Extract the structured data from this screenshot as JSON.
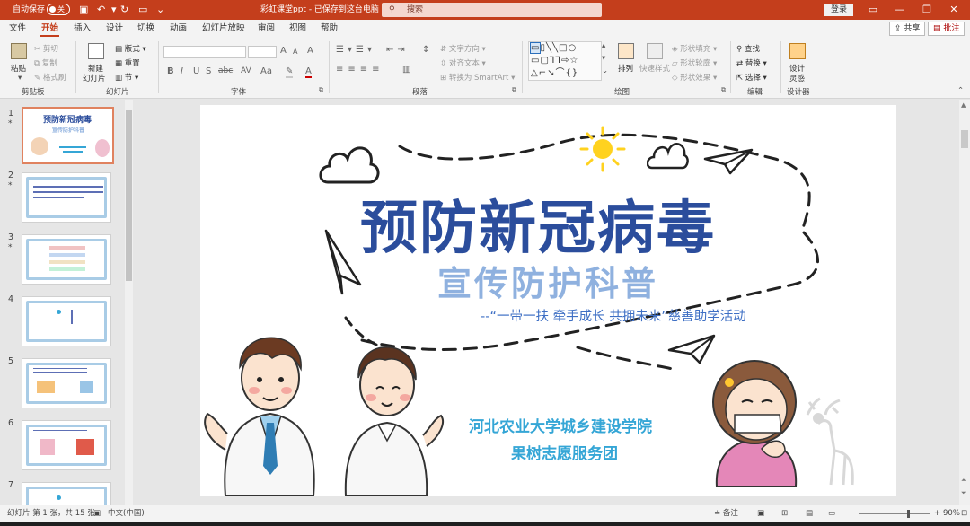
{
  "titlebar": {
    "autosave_label": "自动保存",
    "autosave_state": "关",
    "doc_title": "彩虹课堂ppt - 已保存到这台电脑",
    "search_placeholder": "搜索",
    "login_label": "登录"
  },
  "tabs": [
    "文件",
    "开始",
    "插入",
    "设计",
    "切换",
    "动画",
    "幻灯片放映",
    "审阅",
    "视图",
    "帮助"
  ],
  "active_tab": "开始",
  "share_label": "共享",
  "comment_label": "批注",
  "ribbon": {
    "clipboard": {
      "paste": "粘贴",
      "cut": "剪切",
      "copy": "复制",
      "format_painter": "格式刷",
      "label": "剪贴板"
    },
    "slides": {
      "new_slide_line1": "新建",
      "new_slide_line2": "幻灯片",
      "layout": "版式",
      "reset": "重置",
      "section": "节",
      "label": "幻灯片"
    },
    "font": {
      "label": "字体",
      "bold": "B",
      "italic": "I",
      "underline": "U",
      "strike": "S",
      "shadow": "abc",
      "spacing": "AV",
      "case": "Aa",
      "grow": "A",
      "shrink": "A",
      "clear": "A",
      "color": "A"
    },
    "paragraph": {
      "text_direction": "文字方向",
      "align_text": "对齐文本",
      "smartart": "转换为 SmartArt",
      "label": "段落"
    },
    "drawing": {
      "arrange": "排列",
      "quick_styles": "快速样式",
      "shape_fill": "形状填充",
      "shape_outline": "形状轮廓",
      "shape_effects": "形状效果",
      "label": "绘图"
    },
    "editing": {
      "find": "查找",
      "replace": "替换",
      "select": "选择",
      "label": "编辑"
    },
    "designer": {
      "line1": "设计",
      "line2": "灵感",
      "label": "设计器"
    }
  },
  "thumbnails": [
    {
      "num": "1",
      "star": "*"
    },
    {
      "num": "2",
      "star": "*"
    },
    {
      "num": "3",
      "star": "*"
    },
    {
      "num": "4",
      "star": ""
    },
    {
      "num": "5",
      "star": ""
    },
    {
      "num": "6",
      "star": ""
    },
    {
      "num": "7",
      "star": ""
    }
  ],
  "thumb1": {
    "title": "预防新冠病毒",
    "sub": "宣传防护科普"
  },
  "slide": {
    "title": "预防新冠病毒",
    "subtitle": "宣传防护科普",
    "tagline": "--“一带一扶 牵手成长 共拥未来”慈善助学活动",
    "org1": "河北农业大学城乡建设学院",
    "org2": "果树志愿服务团"
  },
  "statusbar": {
    "slide_info": "幻灯片 第 1 张，共 15 张",
    "language": "中文(中国)",
    "notes": "备注",
    "zoom": "90%"
  },
  "colors": {
    "accent": "#c43e1c",
    "title_blue": "#2b4d9c",
    "subtitle_blue": "#8fb1df",
    "org_cyan": "#35a6d6"
  }
}
